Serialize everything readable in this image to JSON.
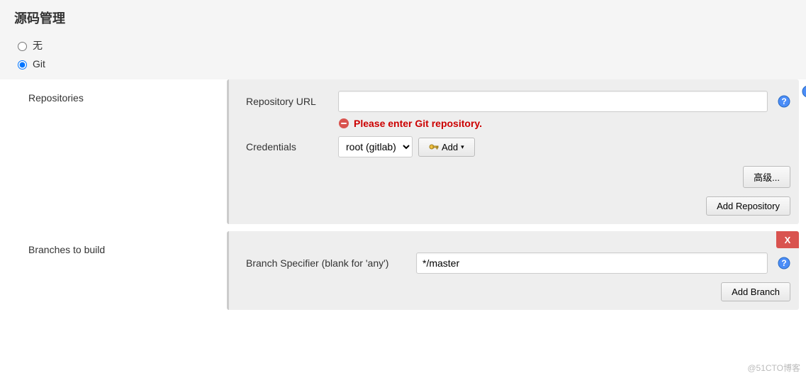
{
  "section": {
    "title": "源码管理"
  },
  "scm": {
    "none_label": "无",
    "git_label": "Git",
    "selected": "git"
  },
  "repositories": {
    "label": "Repositories",
    "repo_url_label": "Repository URL",
    "repo_url_value": "",
    "error_msg": "Please enter Git repository.",
    "credentials_label": "Credentials",
    "credentials_selected": "root (gitlab)",
    "add_cred_label": "Add",
    "advanced_label": "高级...",
    "add_repo_label": "Add Repository"
  },
  "branches": {
    "label": "Branches to build",
    "specifier_label": "Branch Specifier (blank for 'any')",
    "specifier_value": "*/master",
    "delete_label": "X",
    "add_branch_label": "Add Branch"
  },
  "watermark": "@51CTO博客"
}
